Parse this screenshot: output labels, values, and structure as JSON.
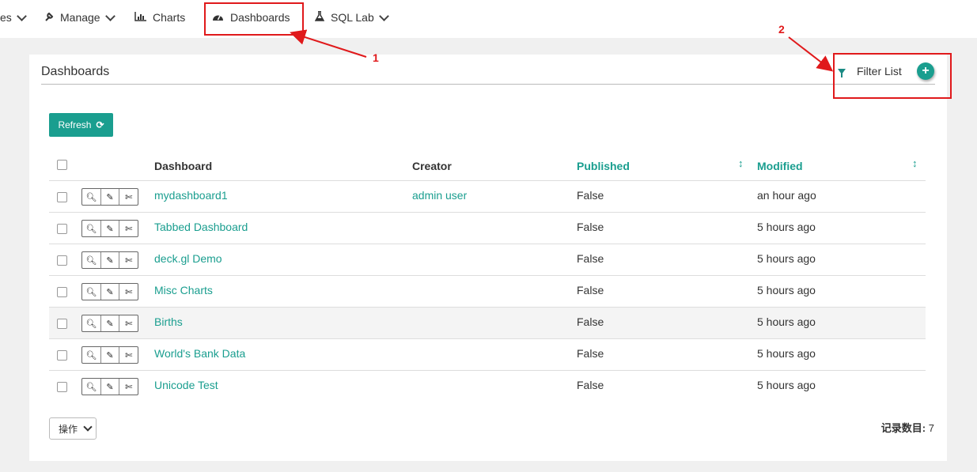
{
  "nav": {
    "items": [
      {
        "label": "es"
      },
      {
        "label": "Manage"
      },
      {
        "label": "Charts"
      },
      {
        "label": "Dashboards"
      },
      {
        "label": "SQL Lab"
      }
    ]
  },
  "annotations": {
    "one": "1",
    "two": "2",
    "color": "#e0191b"
  },
  "panel": {
    "title": "Dashboards",
    "filter_label": "Filter List",
    "add_label": "+",
    "refresh_label": "Refresh",
    "refresh_icon": "⟳"
  },
  "table": {
    "headers": {
      "dashboard": "Dashboard",
      "creator": "Creator",
      "published": "Published",
      "modified": "Modified"
    },
    "rows": [
      {
        "dashboard": "mydashboard1",
        "creator": "admin user",
        "published": "False",
        "modified": "an hour ago"
      },
      {
        "dashboard": "Tabbed Dashboard",
        "creator": "",
        "published": "False",
        "modified": "5 hours ago"
      },
      {
        "dashboard": "deck.gl Demo",
        "creator": "",
        "published": "False",
        "modified": "5 hours ago"
      },
      {
        "dashboard": "Misc Charts",
        "creator": "",
        "published": "False",
        "modified": "5 hours ago"
      },
      {
        "dashboard": "Births",
        "creator": "",
        "published": "False",
        "modified": "5 hours ago"
      },
      {
        "dashboard": "World's Bank Data",
        "creator": "",
        "published": "False",
        "modified": "5 hours ago"
      },
      {
        "dashboard": "Unicode Test",
        "creator": "",
        "published": "False",
        "modified": "5 hours ago"
      }
    ]
  },
  "footer": {
    "ops_label": "操作",
    "count_label": "记录数目:",
    "count_value": "7"
  },
  "colors": {
    "accent": "#1a9e8f",
    "annotation": "#e0191b"
  }
}
